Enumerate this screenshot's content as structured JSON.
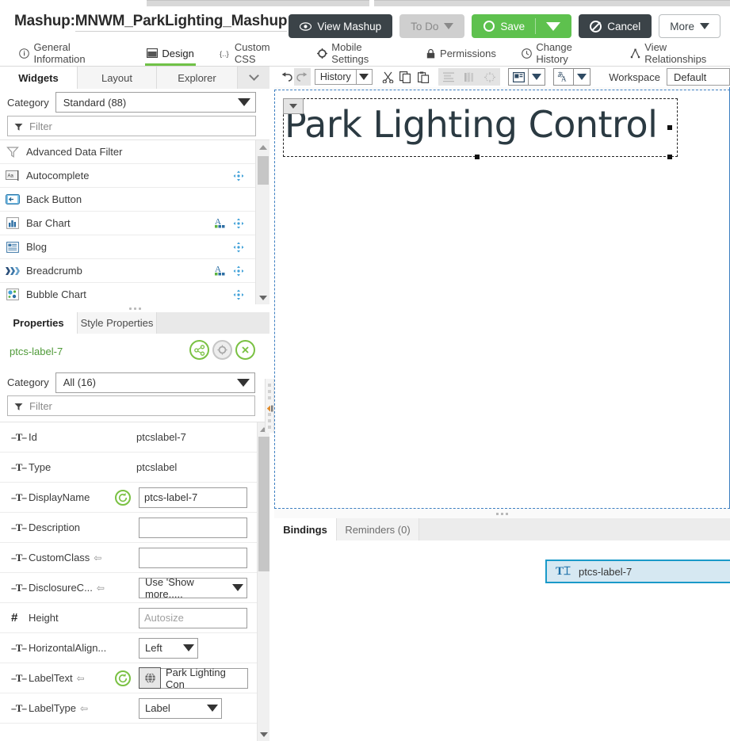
{
  "header": {
    "title_prefix": "Mashup:",
    "title_name": "MNWM_ParkLighting_Mashup",
    "modified_marker": "*",
    "help_glyph": "?",
    "buttons": {
      "view_mashup": "View Mashup",
      "to_do": "To Do",
      "save": "Save",
      "cancel": "Cancel",
      "more": "More"
    }
  },
  "nav_tabs": [
    {
      "label": "General Information",
      "icon": "info-circle-icon",
      "active": false
    },
    {
      "label": "Design",
      "icon": "design-icon",
      "active": true
    },
    {
      "label": "Custom CSS",
      "icon": "braces-icon",
      "active": false
    },
    {
      "label": "Mobile Settings",
      "icon": "gear-icon",
      "active": false
    },
    {
      "label": "Permissions",
      "icon": "lock-icon",
      "active": false
    },
    {
      "label": "Change History",
      "icon": "clock-icon",
      "active": false
    },
    {
      "label": "View Relationships",
      "icon": "relationships-icon",
      "active": false
    }
  ],
  "left_panel": {
    "tabs": [
      {
        "label": "Widgets",
        "active": true
      },
      {
        "label": "Layout",
        "active": false
      },
      {
        "label": "Explorer",
        "active": false
      }
    ],
    "category_label": "Category",
    "category_value": "Standard (88)",
    "filter_placeholder": "Filter",
    "widgets": [
      {
        "name": "Advanced Data Filter",
        "icon": "advanced-data-filter-icon",
        "localizable": false,
        "draggable": false
      },
      {
        "name": "Autocomplete",
        "icon": "autocomplete-icon",
        "localizable": false,
        "draggable": true
      },
      {
        "name": "Back Button",
        "icon": "back-button-icon",
        "localizable": false,
        "draggable": false
      },
      {
        "name": "Bar Chart",
        "icon": "bar-chart-icon",
        "localizable": true,
        "draggable": true
      },
      {
        "name": "Blog",
        "icon": "blog-icon",
        "localizable": false,
        "draggable": true
      },
      {
        "name": "Breadcrumb",
        "icon": "breadcrumb-icon",
        "localizable": true,
        "draggable": true
      },
      {
        "name": "Bubble Chart",
        "icon": "bubble-chart-icon",
        "localizable": false,
        "draggable": true
      }
    ]
  },
  "design_toolbar": {
    "history_label": "History",
    "workspace_label": "Workspace",
    "workspace_value": "Default"
  },
  "properties_panel": {
    "tabs": [
      {
        "label": "Properties",
        "active": true
      },
      {
        "label": "Style Properties",
        "active": false
      }
    ],
    "selected_widget": "ptcs-label-7",
    "category_label": "Category",
    "category_value": "All (16)",
    "filter_placeholder": "Filter",
    "rows": [
      {
        "name": "Id",
        "value": "ptcslabel-7",
        "control": "text",
        "type_icon": "text-type-icon"
      },
      {
        "name": "Type",
        "value": "ptcslabel",
        "control": "text",
        "type_icon": "text-type-icon"
      },
      {
        "name": "DisplayName",
        "value": "ptcs-label-7",
        "control": "input",
        "type_icon": "text-type-icon"
      },
      {
        "name": "Description",
        "value": "",
        "control": "input",
        "type_icon": "text-type-icon"
      },
      {
        "name": "CustomClass",
        "value": "",
        "control": "input",
        "type_icon": "text-type-icon"
      },
      {
        "name": "DisclosureC...",
        "value": "Use 'Show more.....",
        "control": "select",
        "type_icon": "text-type-icon"
      },
      {
        "name": "Height",
        "value": "",
        "placeholder": "Autosize",
        "control": "input",
        "type_icon": "number-type-icon"
      },
      {
        "name": "HorizontalAlign...",
        "value": "Left",
        "control": "select",
        "type_icon": "text-type-icon"
      },
      {
        "name": "LabelText",
        "value": "Park Lighting Con",
        "control": "input-localized",
        "type_icon": "text-type-icon"
      },
      {
        "name": "LabelType",
        "value": "Label",
        "control": "select",
        "type_icon": "text-type-icon"
      }
    ]
  },
  "canvas": {
    "label_text": "Park Lighting Control"
  },
  "bindings_panel": {
    "tabs": [
      {
        "label": "Bindings",
        "active": true
      },
      {
        "label": "Reminders (0)",
        "active": false
      }
    ],
    "nodes": [
      {
        "label": "ptcs-label-7",
        "icon": "text-widget-icon"
      }
    ]
  },
  "colors": {
    "accent_green": "#5ec14e",
    "dark_button": "#3b4348",
    "tab_underline": "#70c247",
    "selection_blue": "#1a9ac9",
    "binding_node_fill": "#d6e8f2",
    "canvas_outline": "#3d7fc1",
    "property_link_green": "#7ac143",
    "widget_name_green": "#4f9a38"
  }
}
